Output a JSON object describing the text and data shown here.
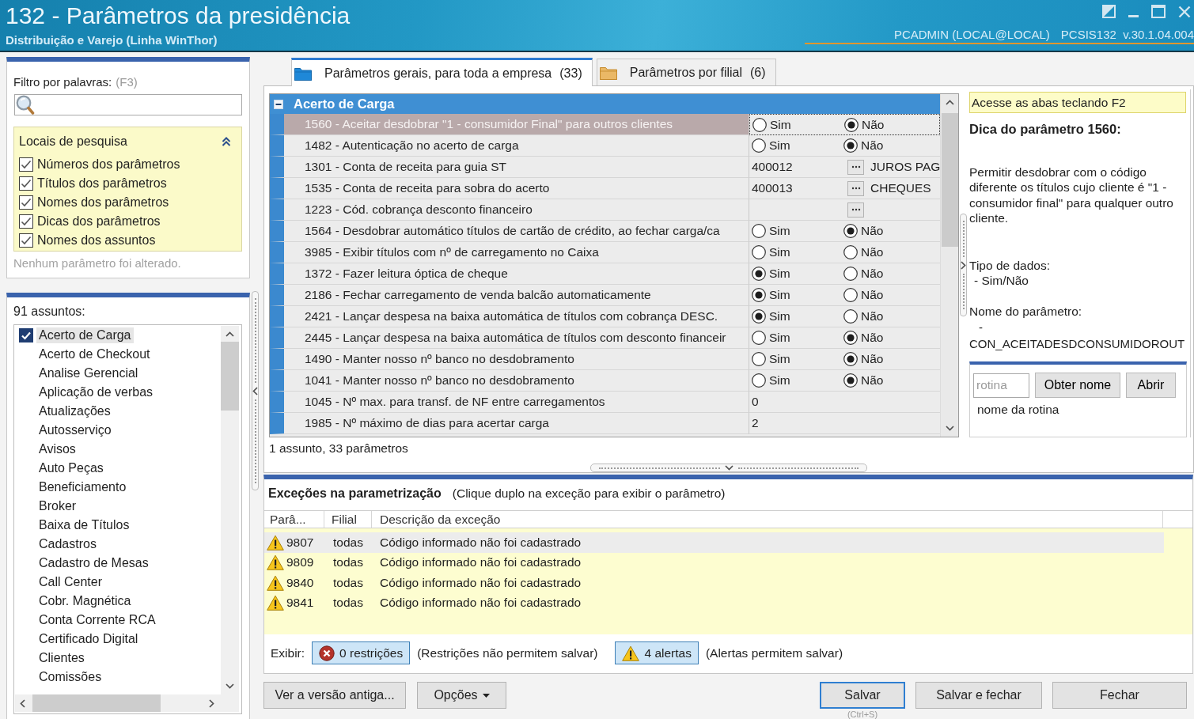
{
  "window": {
    "title": "132 - Parâmetros da presidência",
    "subtitle": "Distribuição e Varejo (Linha WinThor)",
    "user": "PCADMIN (LOCAL@LOCAL)",
    "version": "PCSIS132  v.30.1.04.004"
  },
  "filter": {
    "label": "Filtro por palavras:",
    "shortcut": "(F3)",
    "search_locations": {
      "title": "Locais de pesquisa",
      "expanded": true,
      "options": [
        {
          "label": "Números dos parâmetros",
          "checked": true
        },
        {
          "label": "Títulos dos parâmetros",
          "checked": true
        },
        {
          "label": "Nomes dos parâmetros",
          "checked": true
        },
        {
          "label": "Dicas dos parâmetros",
          "checked": true
        },
        {
          "label": "Nomes dos assuntos",
          "checked": true
        }
      ]
    },
    "status": "Nenhum parâmetro foi alterado."
  },
  "subjects": {
    "count_label": "91 assuntos:",
    "items": [
      {
        "label": "Acerto de Carga",
        "checked": true,
        "selected": true
      },
      {
        "label": "Acerto de Checkout",
        "checked": false,
        "selected": false
      },
      {
        "label": "Analise Gerencial",
        "checked": false,
        "selected": false
      },
      {
        "label": "Aplicação de verbas",
        "checked": false,
        "selected": false
      },
      {
        "label": "Atualizações",
        "checked": false,
        "selected": false
      },
      {
        "label": "Autosserviço",
        "checked": false,
        "selected": false
      },
      {
        "label": "Avisos",
        "checked": false,
        "selected": false
      },
      {
        "label": "Auto Peças",
        "checked": false,
        "selected": false
      },
      {
        "label": "Beneficiamento",
        "checked": false,
        "selected": false
      },
      {
        "label": "Broker",
        "checked": false,
        "selected": false
      },
      {
        "label": "Baixa de Títulos",
        "checked": false,
        "selected": false
      },
      {
        "label": "Cadastros",
        "checked": false,
        "selected": false
      },
      {
        "label": "Cadastro de Mesas",
        "checked": false,
        "selected": false
      },
      {
        "label": "Call Center",
        "checked": false,
        "selected": false
      },
      {
        "label": "Cobr. Magnética",
        "checked": false,
        "selected": false
      },
      {
        "label": "Conta Corrente RCA",
        "checked": false,
        "selected": false
      },
      {
        "label": "Certificado Digital",
        "checked": false,
        "selected": false
      },
      {
        "label": "Clientes",
        "checked": false,
        "selected": false
      },
      {
        "label": "Comissões",
        "checked": false,
        "selected": false
      }
    ]
  },
  "tabs": [
    {
      "label": "Parâmetros gerais, para toda a empresa",
      "count": "(33)",
      "selected": true
    },
    {
      "label": "Parâmetros por filial",
      "count": "(6)",
      "selected": false
    }
  ],
  "grid": {
    "group": {
      "title": "Acerto de Carga",
      "expanded": true
    },
    "rows": [
      {
        "label": "1560 - Aceitar desdobrar \"1 - consumidor Final\" para outros clientes",
        "kind": "radio",
        "selected": true,
        "options": [
          {
            "label": "Sim",
            "selected": false
          },
          {
            "label": "Não",
            "selected": true
          }
        ]
      },
      {
        "label": "1482 - Autenticação no acerto de carga",
        "kind": "radio",
        "selected": false,
        "options": [
          {
            "label": "Sim",
            "selected": false
          },
          {
            "label": "Não",
            "selected": true
          }
        ]
      },
      {
        "label": "1301 - Conta de receita para guia ST",
        "kind": "lookup",
        "selected": false,
        "code": "400012",
        "description": "JUROS PAG"
      },
      {
        "label": "1535 - Conta de receita para sobra do acerto",
        "kind": "lookup",
        "selected": false,
        "code": "400013",
        "description": "CHEQUES"
      },
      {
        "label": "1223 - Cód. cobrança desconto financeiro",
        "kind": "lookup",
        "selected": false
      },
      {
        "label": "1564 - Desdobrar automático títulos de cartão de crédito, ao fechar carga/ca",
        "kind": "radio",
        "selected": false,
        "options": [
          {
            "label": "Sim",
            "selected": false
          },
          {
            "label": "Não",
            "selected": true
          }
        ]
      },
      {
        "label": "3985 - Exibir títulos com nº de carregamento no Caixa",
        "kind": "radio",
        "selected": false,
        "options": [
          {
            "label": "Sim",
            "selected": false
          },
          {
            "label": "Não",
            "selected": false
          }
        ]
      },
      {
        "label": "1372 - Fazer leitura óptica de cheque",
        "kind": "radio",
        "selected": false,
        "options": [
          {
            "label": "Sim",
            "selected": true
          },
          {
            "label": "Não",
            "selected": false
          }
        ]
      },
      {
        "label": "2186 - Fechar carregamento de venda balcão automaticamente",
        "kind": "radio",
        "selected": false,
        "options": [
          {
            "label": "Sim",
            "selected": true
          },
          {
            "label": "Não",
            "selected": false
          }
        ]
      },
      {
        "label": "2421 - Lançar despesa na baixa automática de títulos com cobrança DESC.",
        "kind": "radio",
        "selected": false,
        "options": [
          {
            "label": "Sim",
            "selected": true
          },
          {
            "label": "Não",
            "selected": false
          }
        ]
      },
      {
        "label": "2445 - Lançar despesa na baixa automática de títulos com desconto financeir",
        "kind": "radio",
        "selected": false,
        "options": [
          {
            "label": "Sim",
            "selected": false
          },
          {
            "label": "Não",
            "selected": true
          }
        ]
      },
      {
        "label": "1490 - Manter nosso nº banco no desdobramento",
        "kind": "radio",
        "selected": false,
        "options": [
          {
            "label": "Sim",
            "selected": false
          },
          {
            "label": "Não",
            "selected": true
          }
        ]
      },
      {
        "label": "1041 - Manter nosso nº banco no desdobramento",
        "kind": "radio",
        "selected": false,
        "options": [
          {
            "label": "Sim",
            "selected": false
          },
          {
            "label": "Não",
            "selected": true
          }
        ]
      },
      {
        "label": "1045 - Nº max. para transf. de NF entre carregamentos",
        "kind": "number",
        "selected": false,
        "value": "0"
      },
      {
        "label": "1985 - Nº máximo de dias para acertar carga",
        "kind": "number",
        "selected": false,
        "value": "2"
      }
    ],
    "summary": "1 assunto, 33 parâmetros"
  },
  "tip": {
    "hint": "Acesse as abas teclando F2",
    "title": "Dica do parâmetro 1560:",
    "description": "Permitir desdobrar com o código diferente os títulos cujo cliente é \"1 - consumidor final\" para qualquer outro cliente.",
    "data_type_label": "Tipo de dados:",
    "data_type": "- Sim/Não",
    "name_label": "Nome do parâmetro:",
    "name": "- CON_ACEITADESDCONSUMIDOROUT"
  },
  "routine": {
    "placeholder": "rotina",
    "buttons": [
      "Obter nome",
      "Abrir"
    ],
    "result": "nome da rotina"
  },
  "exceptions": {
    "title": "Exceções na parametrização",
    "note": "(Clique duplo na exceção para exibir o parâmetro)",
    "columns": [
      "Parâ...",
      "Filial",
      "Descrição da exceção"
    ],
    "rows": [
      {
        "kind": "warning",
        "param": "9807",
        "branch": "todas",
        "description": "Código informado não foi cadastrado",
        "selected": true
      },
      {
        "kind": "warning",
        "param": "9809",
        "branch": "todas",
        "description": "Código informado não foi cadastrado",
        "selected": false
      },
      {
        "kind": "warning",
        "param": "9840",
        "branch": "todas",
        "description": "Código informado não foi cadastrado",
        "selected": false
      },
      {
        "kind": "warning",
        "param": "9841",
        "branch": "todas",
        "description": "Código informado não foi cadastrado",
        "selected": false
      }
    ],
    "filter_label": "Exibir:",
    "filters": [
      {
        "kind": "restriction",
        "label": "0 restrições",
        "note": "(Restrições não permitem salvar)",
        "on": true
      },
      {
        "kind": "alert",
        "label": "4 alertas",
        "note": "(Alertas permitem salvar)",
        "on": true
      }
    ]
  },
  "footer": {
    "left_buttons": [
      {
        "label": "Ver a versão antiga...",
        "kind": "plain"
      },
      {
        "label": "Opções",
        "kind": "menu"
      }
    ],
    "right_buttons": [
      {
        "label": "Salvar",
        "default": true,
        "shortcut": "(Ctrl+S)"
      },
      {
        "label": "Salvar e fechar",
        "default": false
      },
      {
        "label": "Fechar",
        "default": false
      }
    ]
  }
}
